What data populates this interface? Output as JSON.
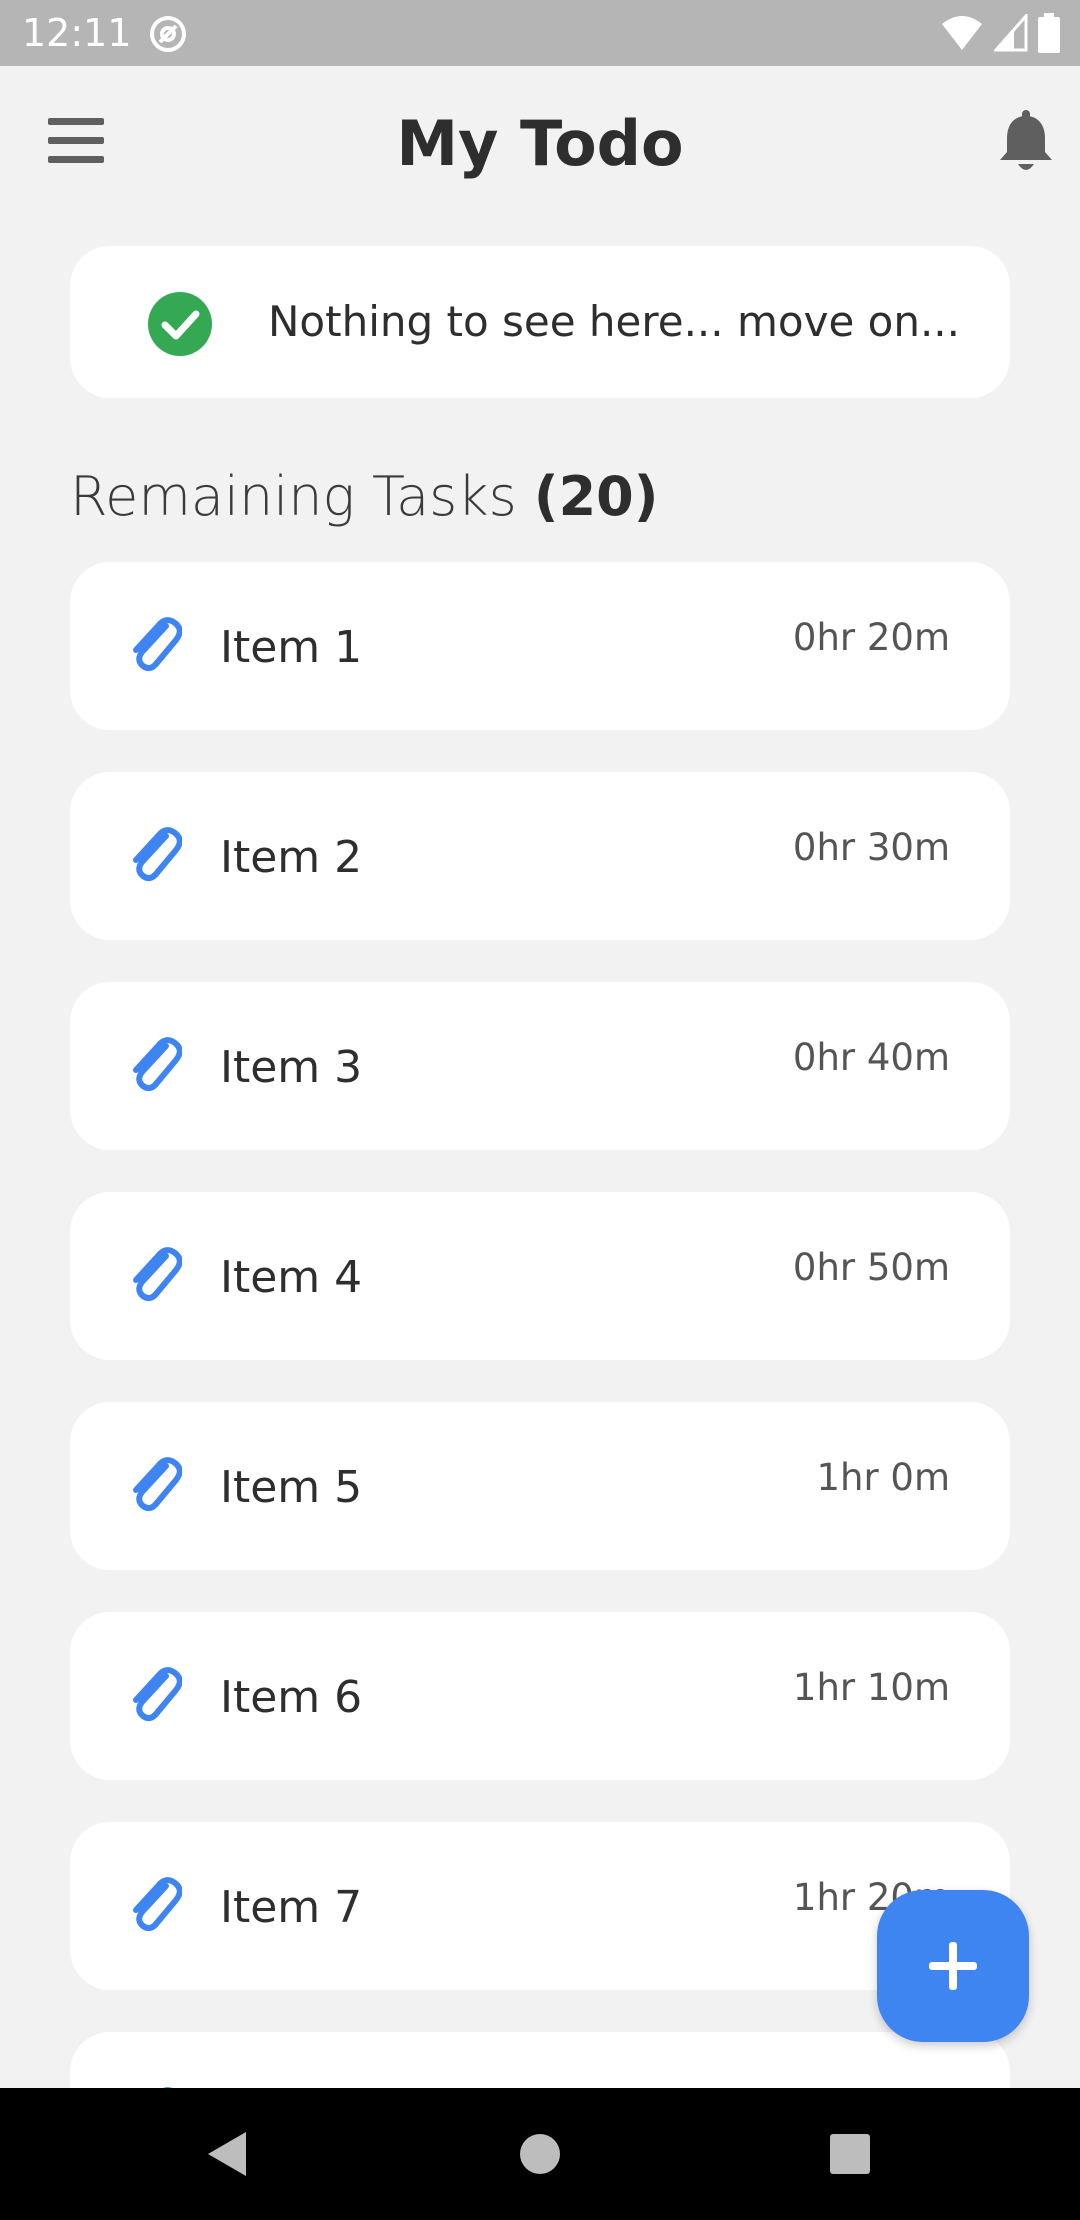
{
  "status_bar": {
    "time": "12:11"
  },
  "app_bar": {
    "title": "My Todo",
    "menu_icon": "hamburger-menu-icon",
    "notification_icon": "bell-icon"
  },
  "banner": {
    "icon": "check-circle-icon",
    "text": "Nothing to see here... move on..."
  },
  "section": {
    "label": "Remaining Tasks",
    "count": "(20)"
  },
  "tasks": [
    {
      "label": "Item 1",
      "duration": "0hr 20m",
      "icon": "paperclip-icon"
    },
    {
      "label": "Item 2",
      "duration": "0hr 30m",
      "icon": "paperclip-icon"
    },
    {
      "label": "Item 3",
      "duration": "0hr 40m",
      "icon": "paperclip-icon"
    },
    {
      "label": "Item 4",
      "duration": "0hr 50m",
      "icon": "paperclip-icon"
    },
    {
      "label": "Item 5",
      "duration": "1hr 0m",
      "icon": "paperclip-icon"
    },
    {
      "label": "Item 6",
      "duration": "1hr 10m",
      "icon": "paperclip-icon"
    },
    {
      "label": "Item 7",
      "duration": "1hr 20m",
      "icon": "paperclip-icon"
    }
  ],
  "fab": {
    "icon": "plus-icon"
  },
  "colors": {
    "accent": "#3f85f2",
    "success": "#34a853",
    "background": "#f2f2f2",
    "card": "#ffffff"
  }
}
